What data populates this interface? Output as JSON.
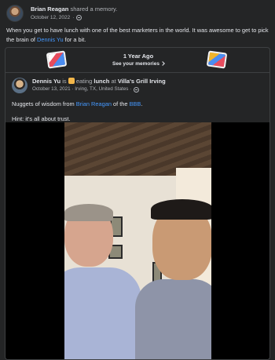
{
  "header": {
    "name": "Brian Reagan",
    "action": "shared a memory.",
    "date": "October 12, 2022",
    "audience_icon": "globe-icon"
  },
  "caption": {
    "text_before": "When you get to have lunch with one of the best marketers in the world.  It was awesome to get to pick the brain of ",
    "link": "Dennis Yu",
    "text_after": " for a bit."
  },
  "memory": {
    "title": "1 Year Ago",
    "see_memories": "See your memories"
  },
  "inner_post": {
    "name": "Dennis Yu",
    "is": "is",
    "activity": "eating",
    "object": "lunch",
    "at": "at",
    "place": "Villa's Grill Irving",
    "date": "October 13, 2021 · Irving, TX, United States ·",
    "line1_before": "Nuggets of wisdom from ",
    "line1_link1": "Brian Reagan",
    "line1_mid": " of the ",
    "line1_link2": "BBB",
    "line1_end": ".",
    "line2": "Hint: it's all about trust."
  },
  "colors": {
    "background": "#242526",
    "link": "#4599ff",
    "secondary_text": "#b0b3b8"
  }
}
